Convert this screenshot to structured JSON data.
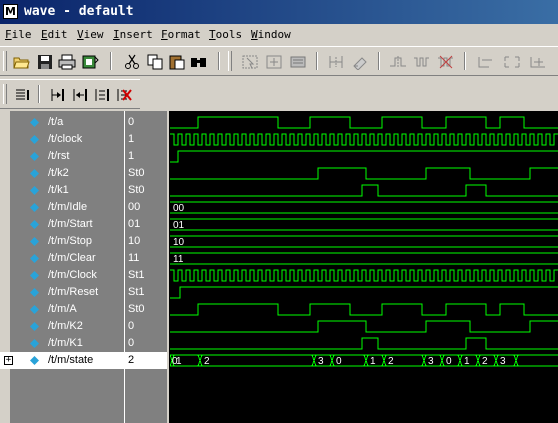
{
  "window": {
    "icon": "M",
    "title": "wave - default"
  },
  "menu": [
    {
      "hot": "F",
      "rest": "ile"
    },
    {
      "hot": "E",
      "rest": "dit"
    },
    {
      "hot": "V",
      "rest": "iew"
    },
    {
      "hot": "I",
      "rest": "nsert"
    },
    {
      "hot": "F",
      "rest": "ormat"
    },
    {
      "hot": "T",
      "rest": "ools"
    },
    {
      "hot": "W",
      "rest": "indow"
    }
  ],
  "signals": [
    {
      "name": "/t/a",
      "value": "0"
    },
    {
      "name": "/t/clock",
      "value": "1"
    },
    {
      "name": "/t/rst",
      "value": "1"
    },
    {
      "name": "/t/k2",
      "value": "St0"
    },
    {
      "name": "/t/k1",
      "value": "St0"
    },
    {
      "name": "/t/m/Idle",
      "value": "00"
    },
    {
      "name": "/t/m/Start",
      "value": "01"
    },
    {
      "name": "/t/m/Stop",
      "value": "10"
    },
    {
      "name": "/t/m/Clear",
      "value": "11"
    },
    {
      "name": "/t/m/Clock",
      "value": "St1"
    },
    {
      "name": "/t/m/Reset",
      "value": "St1"
    },
    {
      "name": "/t/m/A",
      "value": "St0"
    },
    {
      "name": "/t/m/K2",
      "value": "0"
    },
    {
      "name": "/t/m/K1",
      "value": "0"
    },
    {
      "name": "/t/m/state",
      "value": "2"
    }
  ],
  "bus_labels": {
    "idle": "00",
    "start": "01",
    "stop": "10",
    "clear": "11",
    "state": [
      "0",
      "1",
      "2",
      "3",
      "0",
      "1",
      "2",
      "3",
      "0",
      "1",
      "2",
      "3"
    ]
  },
  "colors": {
    "wave": "#00ff00",
    "title_bg": "#0a246a",
    "panel_bg": "#000000",
    "diamond": "#29a3d9"
  }
}
